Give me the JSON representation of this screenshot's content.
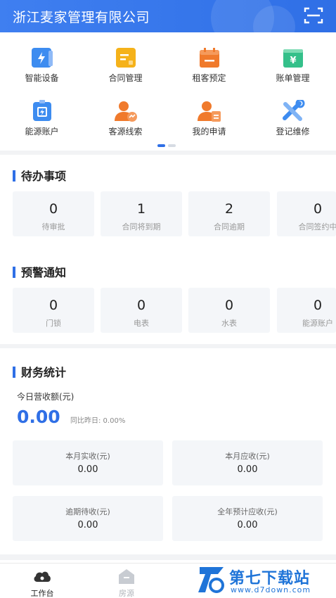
{
  "header": {
    "title": "浙江麦家管理有限公司",
    "scan_icon": "scan-icon"
  },
  "quick_menu": [
    {
      "label": "智能设备",
      "icon": "smart-device-icon",
      "color": "#3d8cf0"
    },
    {
      "label": "合同管理",
      "icon": "contract-icon",
      "color": "#f5b21a"
    },
    {
      "label": "租客预定",
      "icon": "booking-icon",
      "color": "#f07a2c"
    },
    {
      "label": "账单管理",
      "icon": "bill-icon",
      "color": "#34c08a"
    },
    {
      "label": "能源账户",
      "icon": "energy-account-icon",
      "color": "#3d8cf0"
    },
    {
      "label": "客源线索",
      "icon": "customer-lead-icon",
      "color": "#f07a2c"
    },
    {
      "label": "我的申请",
      "icon": "my-application-icon",
      "color": "#f07a2c"
    },
    {
      "label": "登记维修",
      "icon": "repair-icon",
      "color": "#3d8cf0"
    }
  ],
  "todo": {
    "title": "待办事项",
    "items": [
      {
        "value": "0",
        "label": "待审批"
      },
      {
        "value": "1",
        "label": "合同将到期"
      },
      {
        "value": "2",
        "label": "合同逾期"
      },
      {
        "value": "0",
        "label": "合同签约中"
      }
    ]
  },
  "warning": {
    "title": "预警通知",
    "items": [
      {
        "value": "0",
        "label": "门锁"
      },
      {
        "value": "0",
        "label": "电表"
      },
      {
        "value": "0",
        "label": "水表"
      },
      {
        "value": "0",
        "label": "能源账户"
      }
    ]
  },
  "finance": {
    "title": "财务统计",
    "today_label": "今日营收额(元)",
    "today_value": "0.00",
    "compare_text": "同比昨日: 0.00%",
    "cards": [
      {
        "label": "本月实收(元)",
        "value": "0.00"
      },
      {
        "label": "本月应收(元)",
        "value": "0.00"
      },
      {
        "label": "逾期待收(元)",
        "value": "0.00"
      },
      {
        "label": "全年预计应收(元)",
        "value": "0.00"
      }
    ]
  },
  "tabbar": [
    {
      "label": "工作台",
      "icon": "workbench-cloud-icon",
      "active": true
    },
    {
      "label": "房源",
      "icon": "house-icon",
      "active": false
    },
    {
      "label": "",
      "icon": "",
      "active": false
    },
    {
      "label": "",
      "icon": "",
      "active": false
    }
  ],
  "watermark": {
    "name": "第七下载站",
    "url": "www.d7down.com"
  },
  "colors": {
    "primary": "#2f6fe6",
    "card_bg": "#f4f6f9",
    "divider": "#f2f3f5"
  }
}
